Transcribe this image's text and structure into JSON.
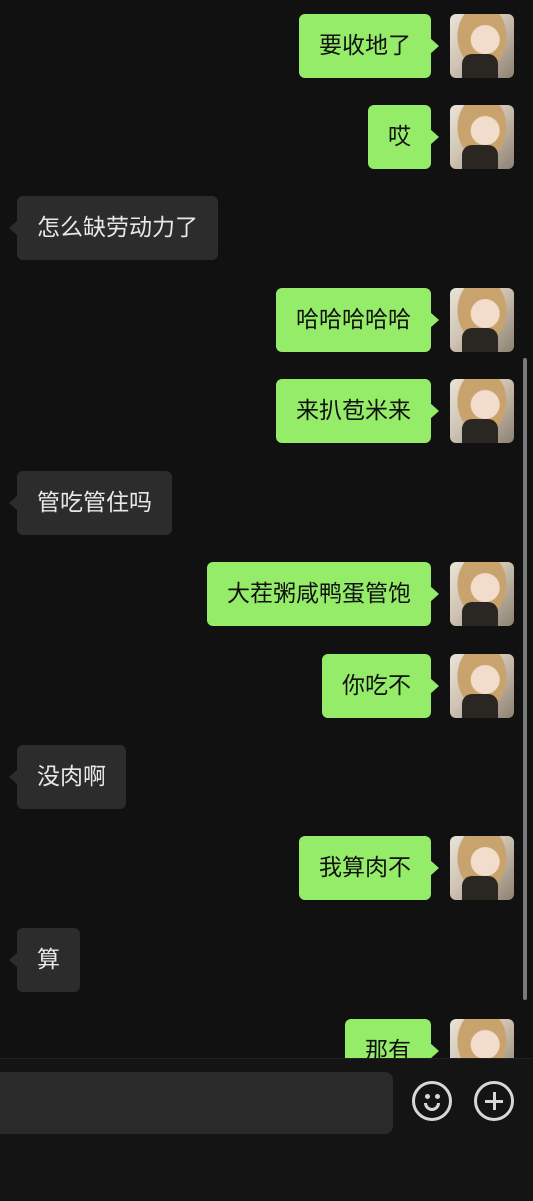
{
  "messages": [
    {
      "side": "out",
      "text": "要收地了"
    },
    {
      "side": "out",
      "text": "哎"
    },
    {
      "side": "in",
      "text": "怎么缺劳动力了"
    },
    {
      "side": "out",
      "text": "哈哈哈哈哈"
    },
    {
      "side": "out",
      "text": "来扒苞米来"
    },
    {
      "side": "in",
      "text": "管吃管住吗"
    },
    {
      "side": "out",
      "text": "大茬粥咸鸭蛋管饱"
    },
    {
      "side": "out",
      "text": "你吃不"
    },
    {
      "side": "in",
      "text": "没肉啊"
    },
    {
      "side": "out",
      "text": "我算肉不"
    },
    {
      "side": "in",
      "text": "算"
    },
    {
      "side": "out",
      "text": "那有"
    }
  ],
  "input_bar": {
    "placeholder": "",
    "emoji_icon": "emoji-icon",
    "more_icon": "plus-icon"
  },
  "colors": {
    "background": "#111111",
    "outgoing_bubble": "#95EC69",
    "incoming_bubble": "#2c2c2c"
  }
}
